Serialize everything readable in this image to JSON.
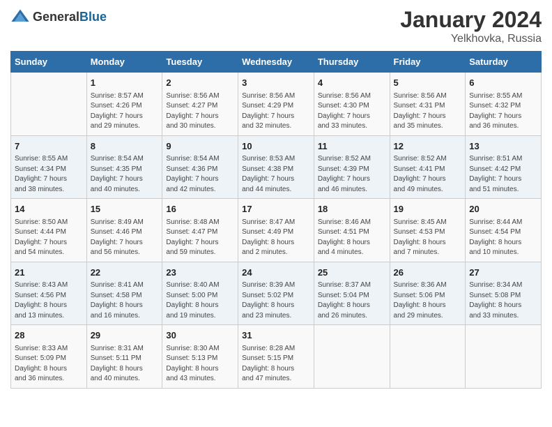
{
  "header": {
    "logo_general": "General",
    "logo_blue": "Blue",
    "month": "January 2024",
    "location": "Yelkhovka, Russia"
  },
  "days_of_week": [
    "Sunday",
    "Monday",
    "Tuesday",
    "Wednesday",
    "Thursday",
    "Friday",
    "Saturday"
  ],
  "weeks": [
    [
      {
        "day": "",
        "info": ""
      },
      {
        "day": "1",
        "info": "Sunrise: 8:57 AM\nSunset: 4:26 PM\nDaylight: 7 hours\nand 29 minutes."
      },
      {
        "day": "2",
        "info": "Sunrise: 8:56 AM\nSunset: 4:27 PM\nDaylight: 7 hours\nand 30 minutes."
      },
      {
        "day": "3",
        "info": "Sunrise: 8:56 AM\nSunset: 4:29 PM\nDaylight: 7 hours\nand 32 minutes."
      },
      {
        "day": "4",
        "info": "Sunrise: 8:56 AM\nSunset: 4:30 PM\nDaylight: 7 hours\nand 33 minutes."
      },
      {
        "day": "5",
        "info": "Sunrise: 8:56 AM\nSunset: 4:31 PM\nDaylight: 7 hours\nand 35 minutes."
      },
      {
        "day": "6",
        "info": "Sunrise: 8:55 AM\nSunset: 4:32 PM\nDaylight: 7 hours\nand 36 minutes."
      }
    ],
    [
      {
        "day": "7",
        "info": "Sunrise: 8:55 AM\nSunset: 4:34 PM\nDaylight: 7 hours\nand 38 minutes."
      },
      {
        "day": "8",
        "info": "Sunrise: 8:54 AM\nSunset: 4:35 PM\nDaylight: 7 hours\nand 40 minutes."
      },
      {
        "day": "9",
        "info": "Sunrise: 8:54 AM\nSunset: 4:36 PM\nDaylight: 7 hours\nand 42 minutes."
      },
      {
        "day": "10",
        "info": "Sunrise: 8:53 AM\nSunset: 4:38 PM\nDaylight: 7 hours\nand 44 minutes."
      },
      {
        "day": "11",
        "info": "Sunrise: 8:52 AM\nSunset: 4:39 PM\nDaylight: 7 hours\nand 46 minutes."
      },
      {
        "day": "12",
        "info": "Sunrise: 8:52 AM\nSunset: 4:41 PM\nDaylight: 7 hours\nand 49 minutes."
      },
      {
        "day": "13",
        "info": "Sunrise: 8:51 AM\nSunset: 4:42 PM\nDaylight: 7 hours\nand 51 minutes."
      }
    ],
    [
      {
        "day": "14",
        "info": "Sunrise: 8:50 AM\nSunset: 4:44 PM\nDaylight: 7 hours\nand 54 minutes."
      },
      {
        "day": "15",
        "info": "Sunrise: 8:49 AM\nSunset: 4:46 PM\nDaylight: 7 hours\nand 56 minutes."
      },
      {
        "day": "16",
        "info": "Sunrise: 8:48 AM\nSunset: 4:47 PM\nDaylight: 7 hours\nand 59 minutes."
      },
      {
        "day": "17",
        "info": "Sunrise: 8:47 AM\nSunset: 4:49 PM\nDaylight: 8 hours\nand 2 minutes."
      },
      {
        "day": "18",
        "info": "Sunrise: 8:46 AM\nSunset: 4:51 PM\nDaylight: 8 hours\nand 4 minutes."
      },
      {
        "day": "19",
        "info": "Sunrise: 8:45 AM\nSunset: 4:53 PM\nDaylight: 8 hours\nand 7 minutes."
      },
      {
        "day": "20",
        "info": "Sunrise: 8:44 AM\nSunset: 4:54 PM\nDaylight: 8 hours\nand 10 minutes."
      }
    ],
    [
      {
        "day": "21",
        "info": "Sunrise: 8:43 AM\nSunset: 4:56 PM\nDaylight: 8 hours\nand 13 minutes."
      },
      {
        "day": "22",
        "info": "Sunrise: 8:41 AM\nSunset: 4:58 PM\nDaylight: 8 hours\nand 16 minutes."
      },
      {
        "day": "23",
        "info": "Sunrise: 8:40 AM\nSunset: 5:00 PM\nDaylight: 8 hours\nand 19 minutes."
      },
      {
        "day": "24",
        "info": "Sunrise: 8:39 AM\nSunset: 5:02 PM\nDaylight: 8 hours\nand 23 minutes."
      },
      {
        "day": "25",
        "info": "Sunrise: 8:37 AM\nSunset: 5:04 PM\nDaylight: 8 hours\nand 26 minutes."
      },
      {
        "day": "26",
        "info": "Sunrise: 8:36 AM\nSunset: 5:06 PM\nDaylight: 8 hours\nand 29 minutes."
      },
      {
        "day": "27",
        "info": "Sunrise: 8:34 AM\nSunset: 5:08 PM\nDaylight: 8 hours\nand 33 minutes."
      }
    ],
    [
      {
        "day": "28",
        "info": "Sunrise: 8:33 AM\nSunset: 5:09 PM\nDaylight: 8 hours\nand 36 minutes."
      },
      {
        "day": "29",
        "info": "Sunrise: 8:31 AM\nSunset: 5:11 PM\nDaylight: 8 hours\nand 40 minutes."
      },
      {
        "day": "30",
        "info": "Sunrise: 8:30 AM\nSunset: 5:13 PM\nDaylight: 8 hours\nand 43 minutes."
      },
      {
        "day": "31",
        "info": "Sunrise: 8:28 AM\nSunset: 5:15 PM\nDaylight: 8 hours\nand 47 minutes."
      },
      {
        "day": "",
        "info": ""
      },
      {
        "day": "",
        "info": ""
      },
      {
        "day": "",
        "info": ""
      }
    ]
  ]
}
